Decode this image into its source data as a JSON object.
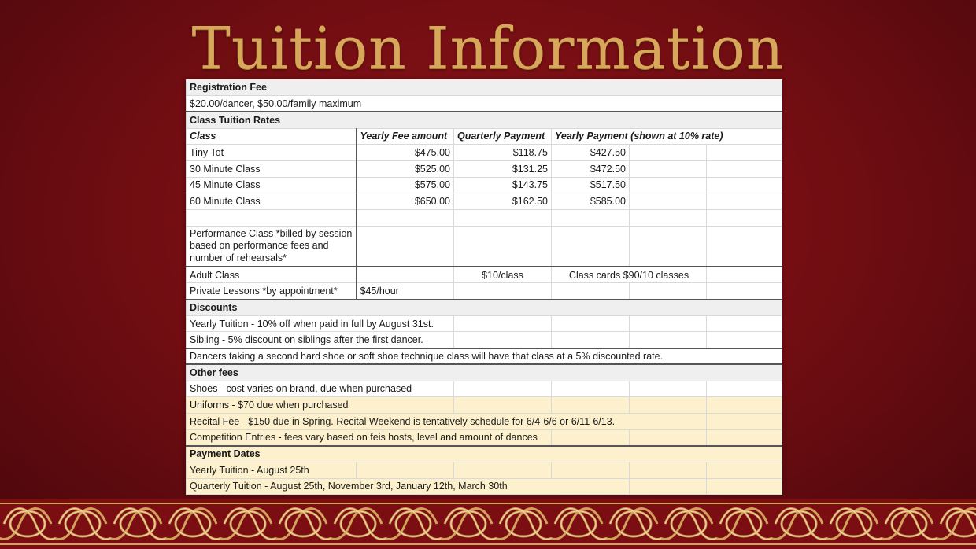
{
  "title": "Tuition Information",
  "registration": {
    "header": "Registration Fee",
    "detail": "$20.00/dancer, $50.00/family maximum"
  },
  "class_rates": {
    "header": "Class Tuition Rates",
    "columns": [
      "Class",
      "Yearly Fee amount",
      "Quarterly Payment",
      "Yearly Payment (shown at 10% rate)"
    ],
    "rows": [
      {
        "class": "Tiny Tot",
        "yearly": "$475.00",
        "quarterly": "$118.75",
        "yearly_payment": "$427.50"
      },
      {
        "class": "30 Minute Class",
        "yearly": "$525.00",
        "quarterly": "$131.25",
        "yearly_payment": "$472.50"
      },
      {
        "class": "45 Minute Class",
        "yearly": "$575.00",
        "quarterly": "$143.75",
        "yearly_payment": "$517.50"
      },
      {
        "class": "60 Minute Class",
        "yearly": "$650.00",
        "quarterly": "$162.50",
        "yearly_payment": "$585.00"
      }
    ],
    "performance": "Performance Class *billed by session based on performance fees and number of rehearsals*",
    "adult": {
      "class": "Adult Class",
      "quarterly": "$10/class",
      "yearly_payment": "Class cards $90/10 classes"
    },
    "private": {
      "class": "Private Lessons *by appointment*",
      "yearly": "$45/hour"
    }
  },
  "discounts": {
    "header": "Discounts",
    "items": [
      "Yearly Tuition - 10% off when paid in full by August 31st.",
      "Sibling - 5% discount on siblings after the first dancer.",
      "Dancers taking a second hard shoe or soft shoe technique class will have that class at a 5% discounted rate."
    ]
  },
  "other_fees": {
    "header": "Other fees",
    "items": [
      "Shoes - cost varies on brand, due when purchased",
      "Uniforms - $70 due when purchased",
      "Recital Fee - $150 due in Spring. Recital Weekend is tentatively schedule for 6/4-6/6 or 6/11-6/13.",
      "Competition Entries - fees vary based on feis hosts, level and amount of dances"
    ]
  },
  "payment_dates": {
    "header": "Payment Dates",
    "items": [
      "Yearly Tuition - August 25th",
      "Quarterly Tuition - August 25th, November 3rd, January 12th, March 30th"
    ]
  },
  "colors": {
    "background": "#7a0e12",
    "title": "#d8a85a",
    "highlight_rows": "#fdf0cc"
  },
  "icons": [
    "celtic-knot-border"
  ]
}
